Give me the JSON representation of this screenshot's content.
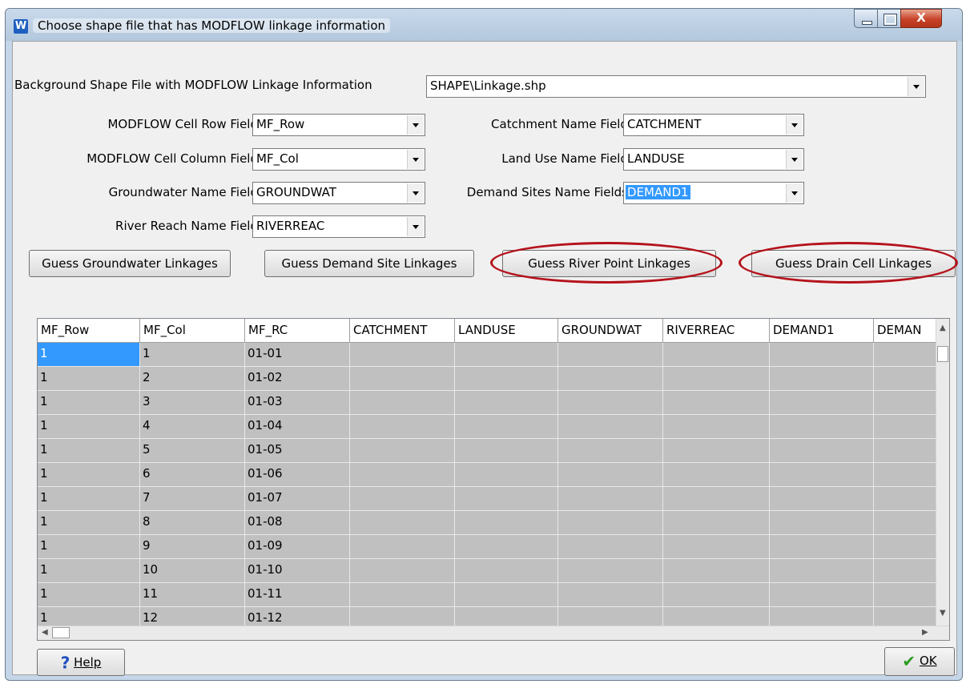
{
  "window": {
    "title": "Choose shape file that has MODFLOW linkage information",
    "app_icon": "W",
    "close_symbol": "X"
  },
  "background_shape": {
    "label": "Background Shape File with MODFLOW Linkage Information",
    "value": "SHAPE\\Linkage.shp"
  },
  "fields": {
    "row": {
      "label": "MODFLOW Cell Row Field",
      "value": "MF_Row"
    },
    "column": {
      "label": "MODFLOW Cell Column Field",
      "value": "MF_Col"
    },
    "groundwater": {
      "label": "Groundwater Name Field",
      "value": "GROUNDWAT"
    },
    "river": {
      "label": "River Reach Name Field",
      "value": "RIVERREAC"
    },
    "catchment": {
      "label": "Catchment Name Field",
      "value": "CATCHMENT"
    },
    "landuse": {
      "label": "Land Use Name Field",
      "value": "LANDUSE"
    },
    "demand": {
      "label": "Demand Sites Name Fields",
      "value": "DEMAND1"
    }
  },
  "buttons": {
    "guess_groundwater": "Guess Groundwater Linkages",
    "guess_demand": "Guess Demand Site Linkages",
    "guess_river": "Guess River Point Linkages",
    "guess_drain": "Guess Drain Cell Linkages",
    "help": "Help",
    "ok": "OK"
  },
  "table": {
    "columns": [
      "MF_Row",
      "MF_Col",
      "MF_RC",
      "CATCHMENT",
      "LANDUSE",
      "GROUNDWAT",
      "RIVERREAC",
      "DEMAND1",
      "DEMAN"
    ],
    "rows": [
      [
        "1",
        "1",
        "01-01"
      ],
      [
        "1",
        "2",
        "01-02"
      ],
      [
        "1",
        "3",
        "01-03"
      ],
      [
        "1",
        "4",
        "01-04"
      ],
      [
        "1",
        "5",
        "01-05"
      ],
      [
        "1",
        "6",
        "01-06"
      ],
      [
        "1",
        "7",
        "01-07"
      ],
      [
        "1",
        "8",
        "01-08"
      ],
      [
        "1",
        "9",
        "01-09"
      ],
      [
        "1",
        "10",
        "01-10"
      ],
      [
        "1",
        "11",
        "01-11"
      ],
      [
        "1",
        "12",
        "01-12"
      ]
    ]
  },
  "colors": {
    "highlight": "#b5121b",
    "selection": "#3399ff",
    "row_bg": "#c0c0c0"
  }
}
